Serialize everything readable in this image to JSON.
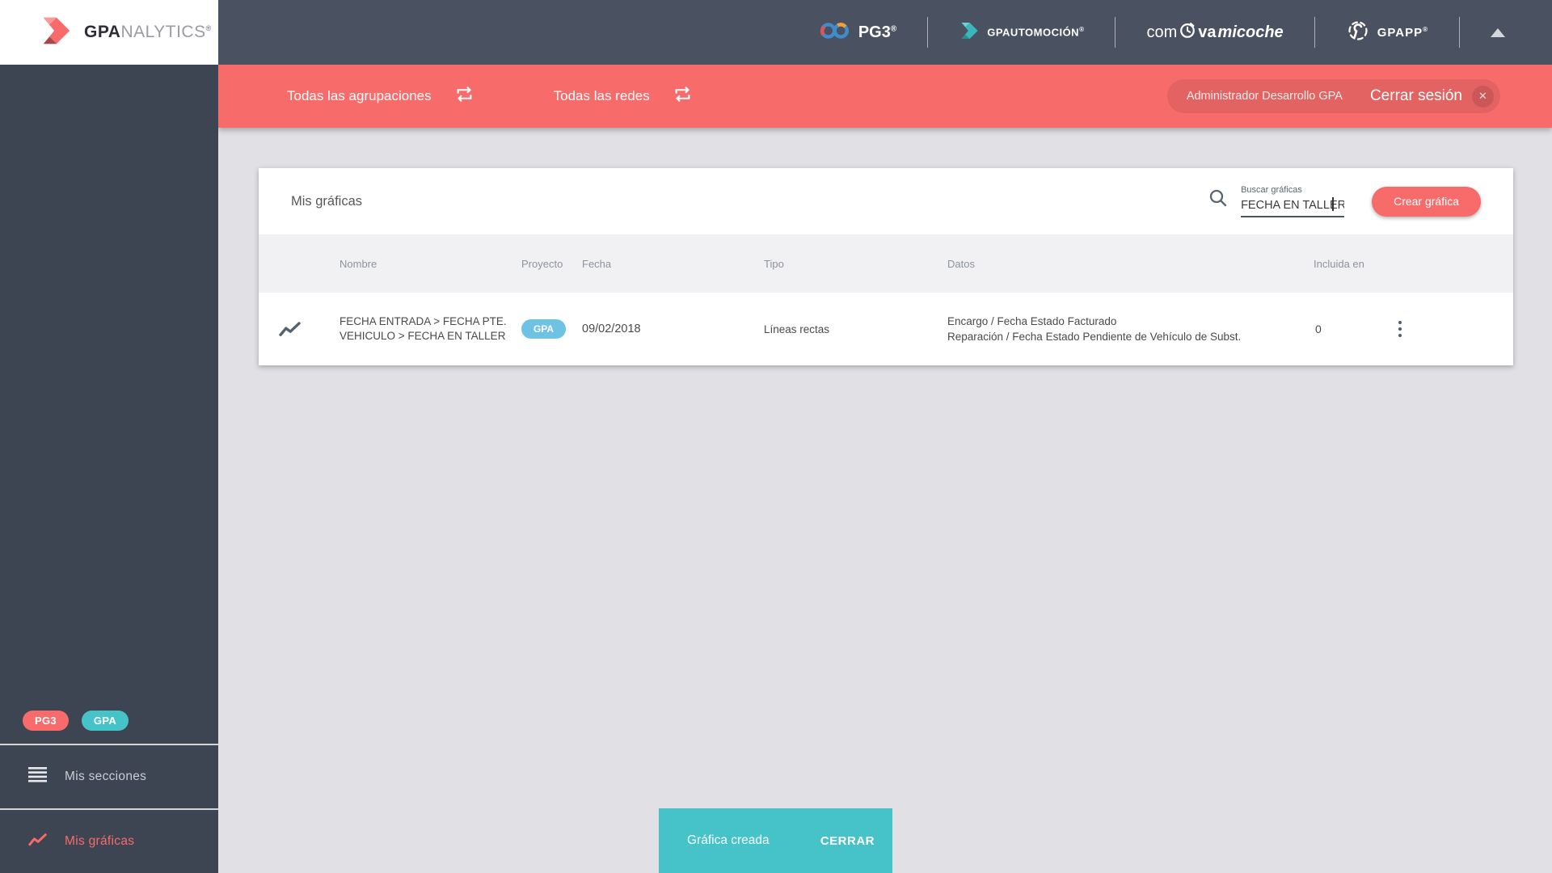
{
  "brand": {
    "bold": "GPA",
    "light": "NALYTICS",
    "reg": "®"
  },
  "topbar": {
    "pg3": {
      "label": "PG3",
      "sup": "®"
    },
    "gpautomocion": {
      "label": "GPAUTOMOCIÓN",
      "sup": "®"
    },
    "comprava": {
      "pre": "com",
      "mid": "va",
      "it": "micoche"
    },
    "gpapp": {
      "label": "GPAPP",
      "sup": "®"
    }
  },
  "filterbar": {
    "groupings": "Todas las agrupaciones",
    "networks": "Todas las redes",
    "user": "Administrador Desarrollo GPA",
    "logout": "Cerrar sesión",
    "close_glyph": "✕"
  },
  "sidebar": {
    "badge_pg3": "PG3",
    "badge_gpa": "GPA",
    "sections": "Mis secciones",
    "charts": "Mis gráficas"
  },
  "content": {
    "title": "Mis gráficas",
    "search": {
      "label": "Buscar gráficas",
      "value": "FECHA EN TALLER"
    },
    "create_button": "Crear gráfica",
    "table": {
      "headers": [
        "Nombre",
        "Proyecto",
        "Fecha",
        "Tipo",
        "Datos",
        "Incluida en"
      ],
      "rows": [
        {
          "nombre": "FECHA ENTRADA > FECHA PTE. VEHICULO > FECHA EN TALLER",
          "proyecto": "GPA",
          "fecha": "09/02/2018",
          "tipo": "Líneas rectas",
          "datos_line1": "Encargo / Fecha Estado Facturado",
          "datos_line2": "Reparación / Fecha Estado Pendiente de Vehículo de Subst.",
          "incluida_en": "0"
        }
      ]
    }
  },
  "toast": {
    "message": "Gráfica creada",
    "action": "CERRAR"
  },
  "colors": {
    "accent_red": "#f76b6b",
    "teal": "#45c3c9",
    "badge_blue": "#6ec3e4",
    "topbar_bg": "#4a5160",
    "sidebar_bg": "#3e4552"
  }
}
